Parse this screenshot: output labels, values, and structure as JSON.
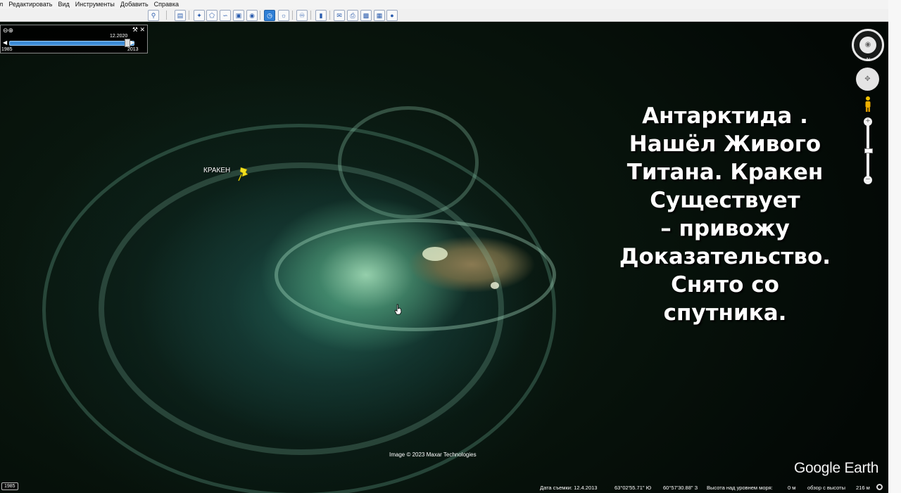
{
  "menu": [
    "йл",
    "Редактировать",
    "Вид",
    "Инструменты",
    "Добавить",
    "Справка"
  ],
  "time_slider": {
    "date": "12.2020",
    "year_min": "1985",
    "year_max": "2013"
  },
  "placemark": {
    "label": "КРАКЕН"
  },
  "overlay_lines": [
    "Антарктида .",
    "Нашёл Живого",
    "Титана. Кракен",
    "Существует",
    "– привожу",
    "Доказательство.",
    "Снято со",
    "спутника."
  ],
  "attribution": "Image © 2023 Maxar Technologies",
  "logo": "Google Earth",
  "year_badge": "1985",
  "status": {
    "capture_date": "Дата съемки: 12.4.2013",
    "latitude": "63°02'55.71\" Ю",
    "longitude": "60°57'30.88\" З",
    "elevation_label": "Высота над уровнем моря:",
    "elevation_value": "0 м",
    "eye_alt_label": "обзор с высоты",
    "eye_alt_value": "216 м"
  },
  "icons": {
    "zoom": "zoom-icon",
    "wrench": "wrench-icon",
    "close": "close-icon",
    "compass": "compass-icon",
    "pushpin": "yellow-pushpin-icon",
    "pegman": "pegman-icon",
    "hand": "hand-cursor-icon"
  },
  "colors": {
    "slider_blue": "#3c8bd6",
    "pin_yellow": "#f2e01e",
    "toolbar_active": "#2f7fd6"
  }
}
